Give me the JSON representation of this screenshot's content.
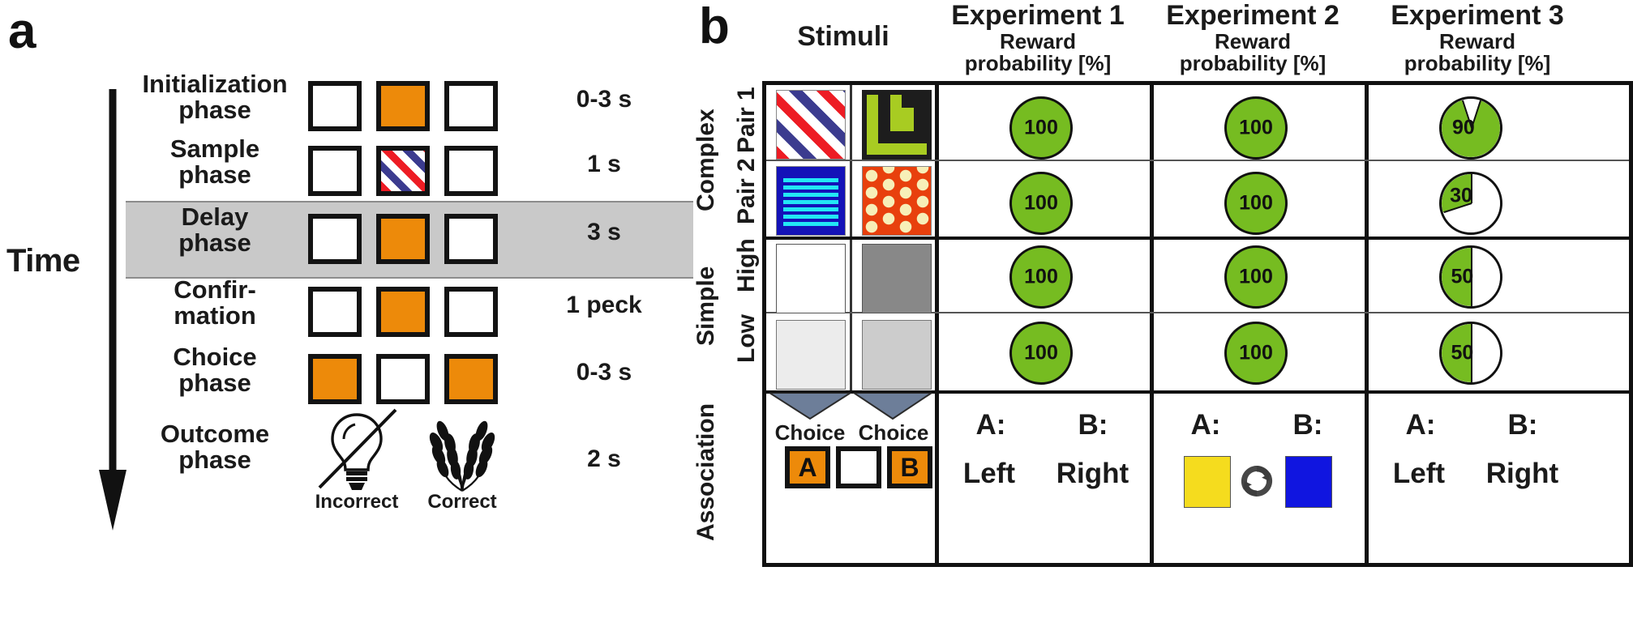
{
  "panel_a": {
    "letter": "a",
    "time_label": "Time",
    "phases": [
      {
        "name": "Initialization\nphase",
        "duration": "0-3 s",
        "boxes": [
          "white",
          "orange",
          "white"
        ]
      },
      {
        "name": "Sample\nphase",
        "duration": "1 s",
        "boxes": [
          "white",
          "stripe",
          "white"
        ]
      },
      {
        "name": "Delay\nphase",
        "duration": "3 s",
        "boxes": [
          "white",
          "orange",
          "white"
        ]
      },
      {
        "name": "Confir-\nmation",
        "duration": "1 peck",
        "boxes": [
          "white",
          "orange",
          "white"
        ]
      },
      {
        "name": "Choice\nphase",
        "duration": "0-3 s",
        "boxes": [
          "orange",
          "white",
          "orange"
        ]
      },
      {
        "name": "Outcome\nphase",
        "duration": "2 s",
        "boxes": []
      }
    ],
    "outcome": {
      "incorrect_label": "Incorrect",
      "correct_label": "Correct",
      "incorrect_icon": "crossed-lightbulb-icon",
      "correct_icon": "wheat-grain-icon"
    },
    "highlight_phase": "Delay phase",
    "colors": {
      "orange": "#ED8A0A",
      "highlight_gray": "#C9C9C9"
    }
  },
  "panel_b": {
    "letter": "b",
    "columns": [
      {
        "id": "stimuli",
        "title": "Stimuli",
        "subtitle": ""
      },
      {
        "id": "experiment-1",
        "title": "Experiment 1",
        "subtitle": "Reward\nprobability [%]"
      },
      {
        "id": "experiment-2",
        "title": "Experiment 2",
        "subtitle": "Reward\nprobability [%]"
      },
      {
        "id": "experiment-3",
        "title": "Experiment 3",
        "subtitle": "Reward\nprobability [%]"
      }
    ],
    "group_labels": [
      {
        "id": "complex",
        "label": "Complex"
      },
      {
        "id": "simple",
        "label": "Simple"
      },
      {
        "id": "association",
        "label": "Association"
      }
    ],
    "rows": [
      {
        "id": "pair-1",
        "label": "Pair 1",
        "group": "Complex",
        "stimulus_a": "diagonal-stripes-red-blue-pattern",
        "stimulus_b": "green-black-maze-pattern"
      },
      {
        "id": "pair-2",
        "label": "Pair 2",
        "group": "Complex",
        "stimulus_a": "blue-cyan-horizontal-lines-pattern",
        "stimulus_b": "orange-cream-dots-pattern"
      },
      {
        "id": "high",
        "label": "High",
        "group": "Simple",
        "stimulus_a": "white-square",
        "stimulus_b": "dark-gray-square"
      },
      {
        "id": "low",
        "label": "Low",
        "group": "Simple",
        "stimulus_a": "very-light-gray-square",
        "stimulus_b": "light-gray-square"
      }
    ],
    "association": {
      "label": "Association",
      "stimuli_cell": {
        "choice_a_caption": "Choice",
        "choice_b_caption": "Choice",
        "box_a": "A",
        "box_middle": "",
        "box_b": "B"
      },
      "experiment_1": {
        "a_label": "A:",
        "a_value": "Left",
        "b_label": "B:",
        "b_value": "Right"
      },
      "experiment_2": {
        "a_label": "A:",
        "a_value": "yellow-square",
        "b_label": "B:",
        "b_value": "blue-square",
        "swap_icon": "refresh-swap-icon"
      },
      "experiment_3": {
        "a_label": "A:",
        "a_value": "Left",
        "b_label": "B:",
        "b_value": "Right"
      }
    },
    "colors": {
      "green": "#76BC21",
      "orange": "#ED8A0A",
      "yellow": "#F5DC1E",
      "blue": "#1015E0",
      "arrow_blue_gray": "#6D7E99"
    }
  },
  "chart_data": {
    "type": "pie",
    "title": "Reward probability [%] per stimulus row and experiment",
    "categories": [
      "Pair 1",
      "Pair 2",
      "High",
      "Low"
    ],
    "series": [
      {
        "name": "Experiment 1",
        "values": [
          100,
          100,
          100,
          100
        ]
      },
      {
        "name": "Experiment 2",
        "values": [
          100,
          100,
          100,
          100
        ]
      },
      {
        "name": "Experiment 3",
        "values": [
          90,
          30,
          50,
          50
        ]
      }
    ],
    "ylabel": "Reward probability [%]",
    "ylim": [
      0,
      100
    ],
    "legend": "none",
    "grid": false,
    "labels": {
      "exp1": [
        "100",
        "100",
        "100",
        "100"
      ],
      "exp2": [
        "100",
        "100",
        "100",
        "100"
      ],
      "exp3": [
        "90",
        "30",
        "50",
        "50"
      ]
    },
    "slice_color": "#76BC21",
    "remainder_color": "#FFFFFF"
  }
}
